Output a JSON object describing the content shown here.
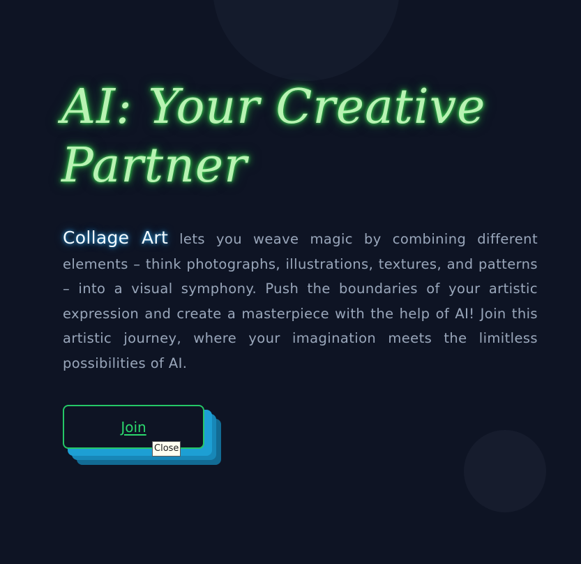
{
  "hero": {
    "title_line1": "AI: Your Creative",
    "title_line2": "Partner",
    "highlight": "Collage Art",
    "description": " lets you weave magic by combining different elements – think photographs, illustrations, textures, and patterns – into a visual symphony. Push the boundaries of your artistic expression and create a masterpiece with the help of AI! Join this artistic journey, where your imagination meets the limitless possibilities of AI."
  },
  "cta": {
    "join_label": "Join",
    "tooltip": "Close"
  },
  "colors": {
    "background": "#0e1424",
    "title_glow": "#39d353",
    "highlight_glow": "#2c9fe6",
    "button_border": "#25c767",
    "button_shadow": "#1d9fd4"
  }
}
